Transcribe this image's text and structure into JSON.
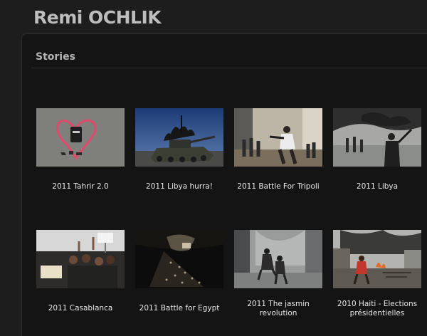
{
  "site": {
    "title": "Remi OCHLIK"
  },
  "section": {
    "title": "Stories"
  },
  "stories": [
    {
      "caption": "2011 Tahrir 2.0",
      "thumb": "tahrir-heart-graffiti"
    },
    {
      "caption": "2011 Libya hurra!",
      "thumb": "libya-tank-crowd"
    },
    {
      "caption": "2011 Battle For Tripoli",
      "thumb": "tripoli-fighters-street"
    },
    {
      "caption": "2011 Libya",
      "thumb": "libya-fighters-smoke"
    },
    {
      "caption": "2011 Casablanca",
      "thumb": "casablanca-protest-signs"
    },
    {
      "caption": "2011 Battle for Egypt",
      "thumb": "egypt-aerial-night"
    },
    {
      "caption": "2011 The jasmin revolution",
      "thumb": "jasmin-tear-gas-street"
    },
    {
      "caption": "2010 Haiti - Elections présidentielles",
      "thumb": "haiti-fires-street"
    }
  ]
}
